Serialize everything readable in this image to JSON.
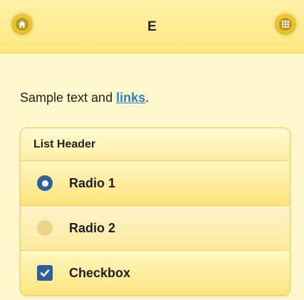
{
  "header": {
    "title": "E",
    "home_icon": "home-icon",
    "grid_icon": "grid-icon"
  },
  "content": {
    "sample_text": "Sample text and ",
    "link_text": "links",
    "period": "."
  },
  "list": {
    "header": "List Header",
    "items": [
      {
        "label": "Radio 1",
        "control": "radio",
        "checked": true
      },
      {
        "label": "Radio 2",
        "control": "radio",
        "checked": false
      },
      {
        "label": "Checkbox",
        "control": "checkbox",
        "checked": true
      }
    ]
  },
  "colors": {
    "background": "#fff8cc",
    "header_bg": "#fce87e",
    "accent_blue": "#2f5f94",
    "link": "#2a7fc0"
  }
}
